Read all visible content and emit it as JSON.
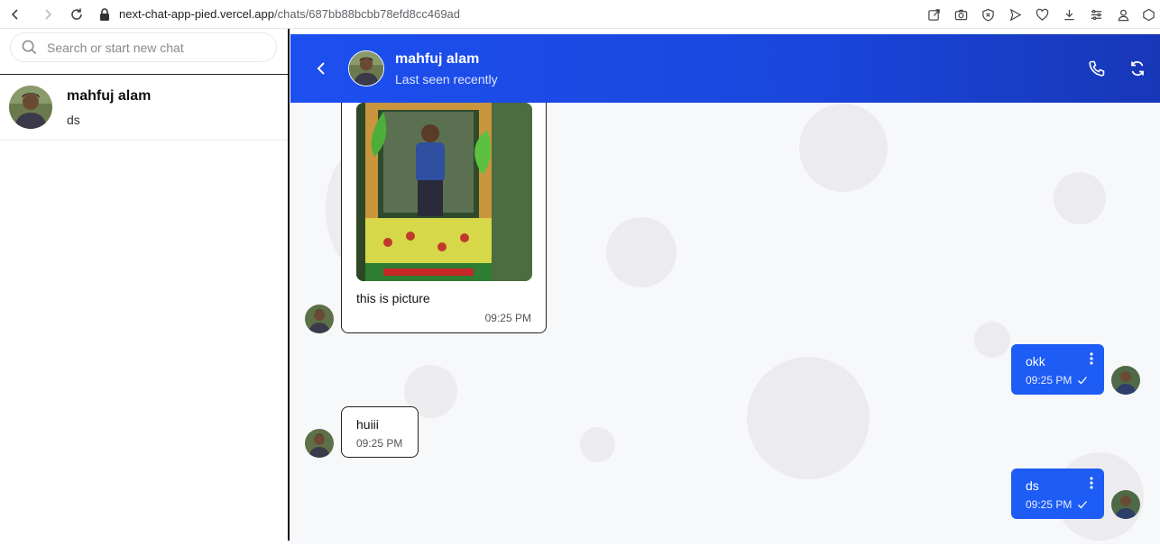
{
  "browser": {
    "url_host": "next-chat-app-pied.vercel.app",
    "url_path": "/chats/687bb88bcbb78efd8cc469ad"
  },
  "sidebar": {
    "search_placeholder": "Search or start new chat",
    "chats": [
      {
        "name": "mahfuj alam",
        "preview": "ds"
      }
    ]
  },
  "header": {
    "name": "mahfuj alam",
    "status": "Last seen recently"
  },
  "messages": [
    {
      "direction": "incoming",
      "type": "image",
      "text": "this is picture",
      "time": "09:25 PM"
    },
    {
      "direction": "outgoing",
      "text": "okk",
      "time": "09:25 PM",
      "status": "sent"
    },
    {
      "direction": "incoming",
      "text": "huiii",
      "time": "09:25 PM"
    },
    {
      "direction": "outgoing",
      "text": "ds",
      "time": "09:25 PM",
      "status": "sent"
    }
  ],
  "colors": {
    "header_start": "#1d4ff0",
    "header_end": "#1737b8",
    "outgoing_bubble": "#1d5cf5",
    "chat_background": "#f7f8fa"
  },
  "icons": [
    "back-icon",
    "forward-icon",
    "reload-icon",
    "lock-icon",
    "search-icon",
    "chevron-left-icon",
    "phone-icon",
    "refresh-icon",
    "kebab-menu-icon",
    "check-icon"
  ]
}
